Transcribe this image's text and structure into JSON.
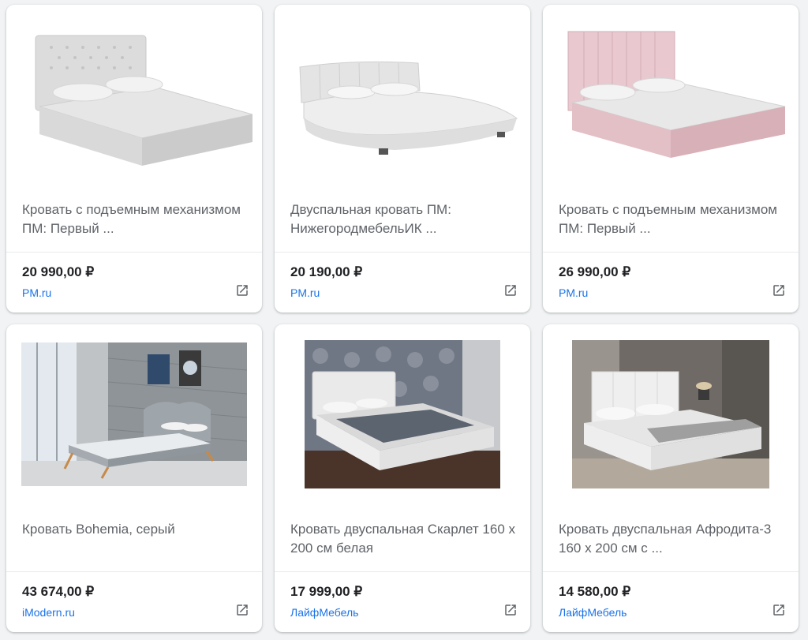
{
  "colors": {
    "price": "#202124",
    "title": "#5f6368",
    "source_link": "#1a73e8",
    "card_bg": "#ffffff",
    "page_bg": "#f1f3f4"
  },
  "products": [
    {
      "title": "Кровать с подъемным механизмом ПМ: Первый ...",
      "price": "20 990,00 ₽",
      "source": "PM.ru",
      "image": "white-tufted-bed-photo",
      "icon": "open-in-new-icon"
    },
    {
      "title": "Двуспальная кровать ПМ: НижегородмебельИК ...",
      "price": "20 190,00 ₽",
      "source": "PM.ru",
      "image": "white-curved-bed-photo",
      "icon": "open-in-new-icon"
    },
    {
      "title": "Кровать с подъемным механизмом ПМ: Первый ...",
      "price": "26 990,00 ₽",
      "source": "PM.ru",
      "image": "pink-bed-photo",
      "icon": "open-in-new-icon"
    },
    {
      "title": "Кровать Bohemia, серый",
      "price": "43 674,00 ₽",
      "source": "iModern.ru",
      "image": "grey-bohemia-bed-room-photo",
      "icon": "open-in-new-icon"
    },
    {
      "title": "Кровать двуспальная Скарлет 160 х 200 см белая",
      "price": "17 999,00 ₽",
      "source": "ЛайфМебель",
      "image": "white-scarlet-bed-room-photo",
      "icon": "open-in-new-icon"
    },
    {
      "title": "Кровать двуспальная Афродита-3 160 х 200 см с ...",
      "price": "14 580,00 ₽",
      "source": "ЛайфМебель",
      "image": "white-afrodita-bed-room-photo",
      "icon": "open-in-new-icon"
    }
  ]
}
